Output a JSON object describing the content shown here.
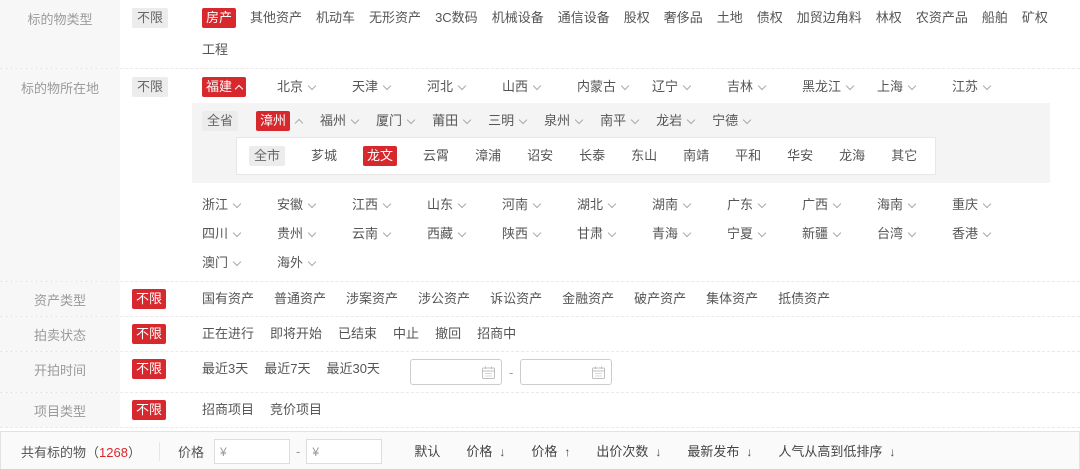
{
  "colors": {
    "accent": "#d7282d",
    "panel_bg": "#f4f4f4",
    "label_bg": "#f7f7f7"
  },
  "filters": {
    "subject_type": {
      "label": "标的物类型",
      "unlim": [
        {
          "t": "不限",
          "tag": true
        }
      ],
      "items": [
        {
          "t": "房产",
          "sel": true
        },
        {
          "t": "其他资产"
        },
        {
          "t": "机动车"
        },
        {
          "t": "无形资产"
        },
        {
          "t": "3C数码"
        },
        {
          "t": "机械设备"
        },
        {
          "t": "通信设备"
        },
        {
          "t": "股权"
        },
        {
          "t": "奢侈品"
        },
        {
          "t": "土地"
        },
        {
          "t": "债权"
        },
        {
          "t": "加贸边角料"
        },
        {
          "t": "林权"
        },
        {
          "t": "农资产品"
        },
        {
          "t": "船舶"
        },
        {
          "t": "矿权"
        },
        {
          "t": "工程"
        }
      ]
    },
    "location": {
      "label": "标的物所在地",
      "unlim": [
        {
          "t": "不限",
          "tag": true
        }
      ],
      "prov1": [
        {
          "t": "福建",
          "sel": true,
          "chev": "upw"
        },
        {
          "t": "北京",
          "chev": "down"
        },
        {
          "t": "天津",
          "chev": "down"
        },
        {
          "t": "河北",
          "chev": "down"
        },
        {
          "t": "山西",
          "chev": "down"
        },
        {
          "t": "内蒙古",
          "chev": "down"
        },
        {
          "t": "辽宁",
          "chev": "down"
        },
        {
          "t": "吉林",
          "chev": "down"
        },
        {
          "t": "黑龙江",
          "chev": "down"
        },
        {
          "t": "上海",
          "chev": "down"
        },
        {
          "t": "江苏",
          "chev": "down"
        }
      ],
      "cities": [
        {
          "t": "全省",
          "tag": true
        },
        {
          "t": "漳州",
          "sel": true,
          "chev": "up"
        },
        {
          "t": "福州",
          "chev": "down"
        },
        {
          "t": "厦门",
          "chev": "down"
        },
        {
          "t": "莆田",
          "chev": "down"
        },
        {
          "t": "三明",
          "chev": "down"
        },
        {
          "t": "泉州",
          "chev": "down"
        },
        {
          "t": "南平",
          "chev": "down"
        },
        {
          "t": "龙岩",
          "chev": "down"
        },
        {
          "t": "宁德",
          "chev": "down"
        }
      ],
      "districts": [
        {
          "t": "全市",
          "tag": true
        },
        {
          "t": "芗城"
        },
        {
          "t": "龙文",
          "sel": true
        },
        {
          "t": "云霄"
        },
        {
          "t": "漳浦"
        },
        {
          "t": "诏安"
        },
        {
          "t": "长泰"
        },
        {
          "t": "东山"
        },
        {
          "t": "南靖"
        },
        {
          "t": "平和"
        },
        {
          "t": "华安"
        },
        {
          "t": "龙海"
        },
        {
          "t": "其它"
        }
      ],
      "prov_rest": [
        {
          "t": "浙江",
          "chev": "down"
        },
        {
          "t": "安徽",
          "chev": "down"
        },
        {
          "t": "江西",
          "chev": "down"
        },
        {
          "t": "山东",
          "chev": "down"
        },
        {
          "t": "河南",
          "chev": "down"
        },
        {
          "t": "湖北",
          "chev": "down"
        },
        {
          "t": "湖南",
          "chev": "down"
        },
        {
          "t": "广东",
          "chev": "down"
        },
        {
          "t": "广西",
          "chev": "down"
        },
        {
          "t": "海南",
          "chev": "down"
        },
        {
          "t": "重庆",
          "chev": "down"
        },
        {
          "t": "四川",
          "chev": "down"
        },
        {
          "t": "贵州",
          "chev": "down"
        },
        {
          "t": "云南",
          "chev": "down"
        },
        {
          "t": "西藏",
          "chev": "down"
        },
        {
          "t": "陕西",
          "chev": "down"
        },
        {
          "t": "甘肃",
          "chev": "down"
        },
        {
          "t": "青海",
          "chev": "down"
        },
        {
          "t": "宁夏",
          "chev": "down"
        },
        {
          "t": "新疆",
          "chev": "down"
        },
        {
          "t": "台湾",
          "chev": "down"
        },
        {
          "t": "香港",
          "chev": "down"
        },
        {
          "t": "澳门",
          "chev": "down"
        },
        {
          "t": "海外",
          "chev": "down"
        }
      ]
    },
    "asset_type": {
      "label": "资产类型",
      "unlim": [
        {
          "t": "不限",
          "sel": true
        }
      ],
      "items": [
        {
          "t": "国有资产"
        },
        {
          "t": "普通资产"
        },
        {
          "t": "涉案资产"
        },
        {
          "t": "涉公资产"
        },
        {
          "t": "诉讼资产"
        },
        {
          "t": "金融资产"
        },
        {
          "t": "破产资产"
        },
        {
          "t": "集体资产"
        },
        {
          "t": "抵债资产"
        }
      ]
    },
    "auction_status": {
      "label": "拍卖状态",
      "unlim": [
        {
          "t": "不限",
          "sel": true
        }
      ],
      "items": [
        {
          "t": "正在进行"
        },
        {
          "t": "即将开始"
        },
        {
          "t": "已结束"
        },
        {
          "t": "中止"
        },
        {
          "t": "撤回"
        },
        {
          "t": "招商中"
        }
      ]
    },
    "start_time": {
      "label": "开拍时间",
      "unlim": [
        {
          "t": "不限",
          "sel": true
        }
      ],
      "items": [
        {
          "t": "最近3天"
        },
        {
          "t": "最近7天"
        },
        {
          "t": "最近30天"
        }
      ],
      "date_from": "",
      "date_to": "",
      "range_separator": "-"
    },
    "project_type": {
      "label": "项目类型",
      "unlim": [
        {
          "t": "不限",
          "sel": true
        }
      ],
      "items": [
        {
          "t": "招商项目"
        },
        {
          "t": "竞价项目"
        }
      ]
    }
  },
  "footer": {
    "total_prefix": "共有标的物（",
    "total_count": "1268",
    "total_suffix": "）",
    "price_label": "价格",
    "currency": "¥",
    "price_min": "",
    "price_max": "",
    "range_separator": "-",
    "sort_options": [
      {
        "t": "默认"
      },
      {
        "t": "价格",
        "arrow": "down"
      },
      {
        "t": "价格",
        "arrow": "up"
      },
      {
        "t": "出价次数",
        "arrow": "down"
      },
      {
        "t": "最新发布",
        "arrow": "down"
      },
      {
        "t": "人气从高到低排序",
        "arrow": "down"
      }
    ]
  }
}
